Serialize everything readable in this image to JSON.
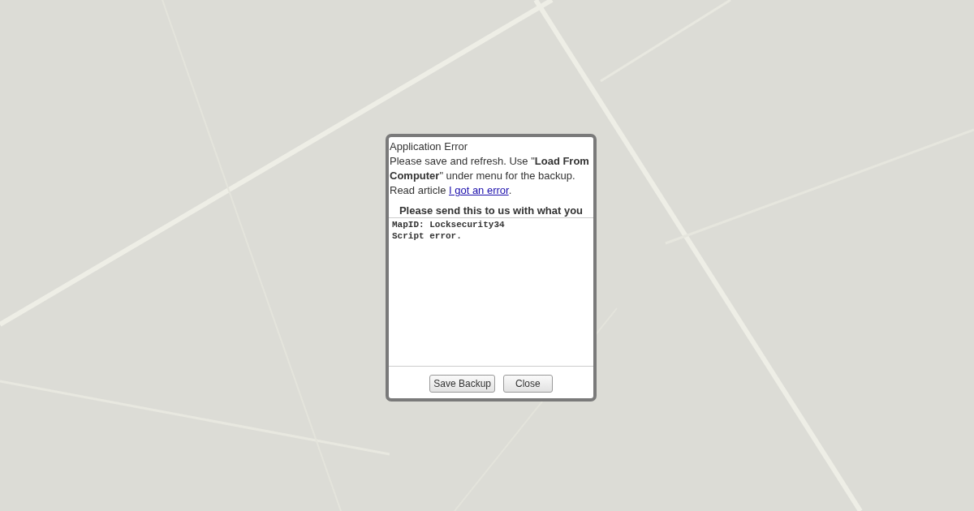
{
  "dialog": {
    "title": "Application Error",
    "message": "Please save and refresh. Use \"**Load From Computer**\" under menu for the backup. Read article ",
    "link": "I got an error",
    "message_end": ".",
    "report_heading": "Please send this to us with what you",
    "report": "MapID: Locksecurity34\nScript error.",
    "buttons": [
      "Save Backup",
      "Close"
    ]
  }
}
